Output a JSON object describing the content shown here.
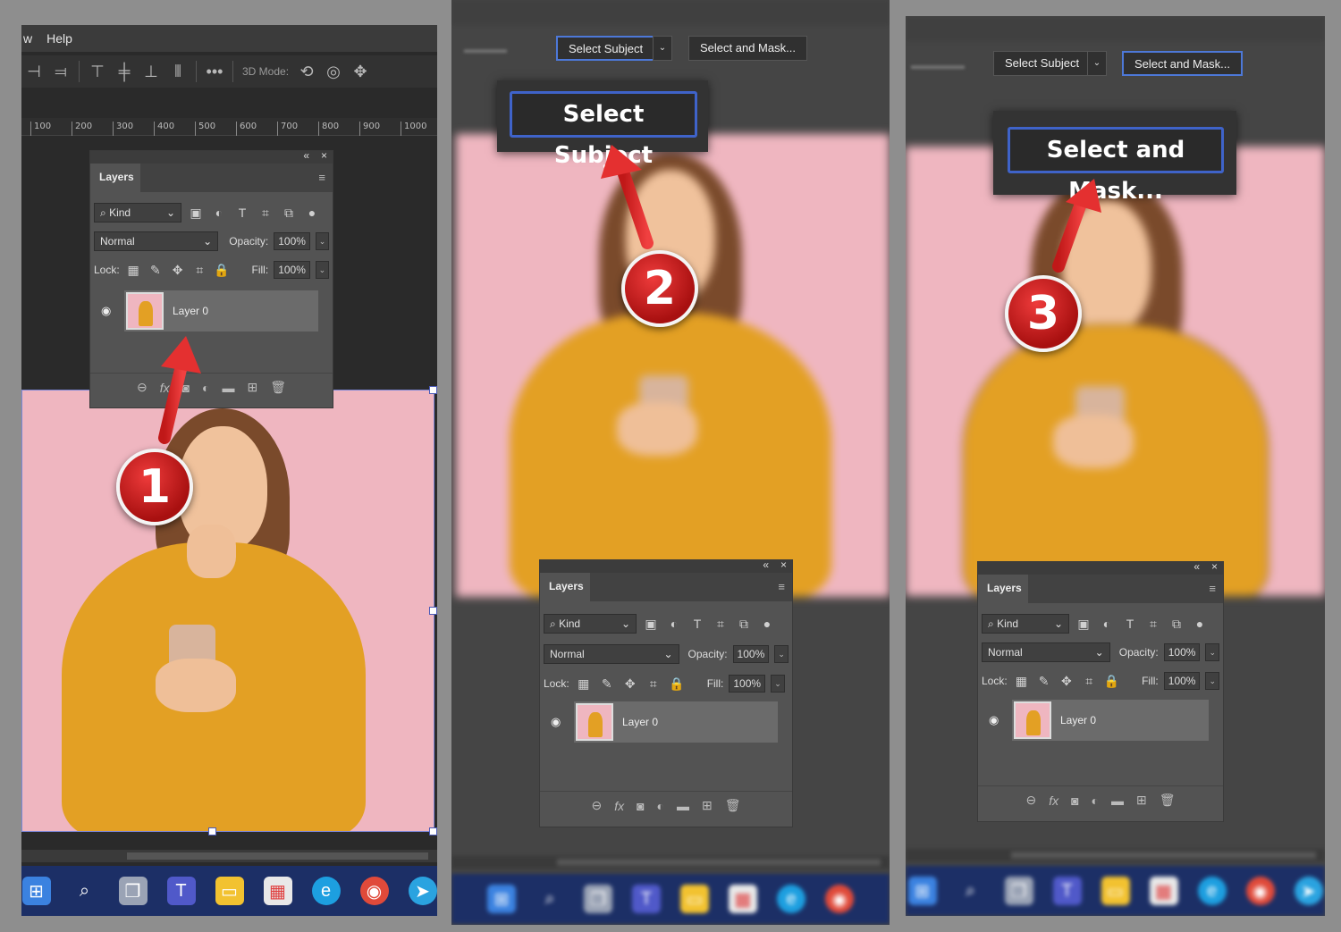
{
  "panel1": {
    "menu": [
      "w",
      "Help"
    ],
    "mode_label": "3D Mode:",
    "ruler": [
      "100",
      "200",
      "300",
      "400",
      "500",
      "600",
      "700",
      "800",
      "900",
      "1000"
    ],
    "step": "1"
  },
  "panel2": {
    "select_subject": "Select Subject",
    "select_and_mask": "Select and Mask...",
    "zoom_label": "Select Subject",
    "step": "2"
  },
  "panel3": {
    "select_subject": "Select Subject",
    "select_and_mask": "Select and Mask...",
    "zoom_label": "Select and Mask...",
    "step": "3"
  },
  "layers": {
    "tab": "Layers",
    "filter": "Kind",
    "blend": "Normal",
    "opacity_label": "Opacity:",
    "opacity": "100%",
    "lock_label": "Lock:",
    "fill_label": "Fill:",
    "fill": "100%",
    "layer_name": "Layer 0"
  },
  "icons": {
    "collapse": "«",
    "close": "×",
    "menu": "≡",
    "eye": "👁",
    "search": "🔍"
  },
  "colors": {
    "accent": "#4d78d8",
    "badge": "#d42020",
    "background_pink": "#efb6c0",
    "sweater": "#e3a024",
    "taskbar": "#1c2f66"
  }
}
